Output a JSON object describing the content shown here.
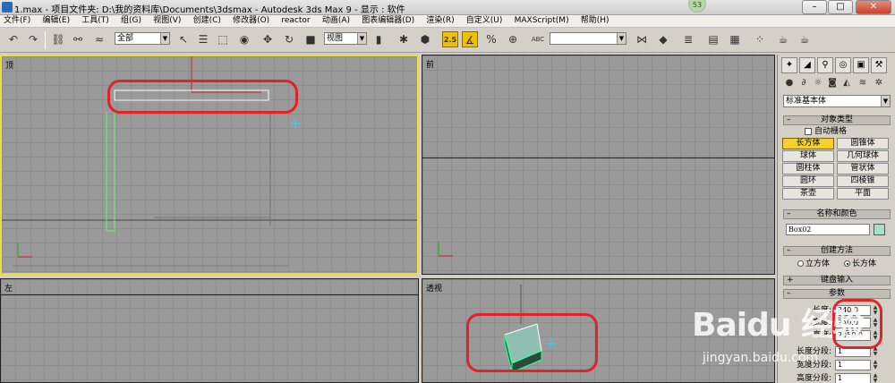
{
  "window": {
    "title": "1.max    - 项目文件夹: D:\\我的资料库\\Documents\\3dsmax    - Autodesk 3ds Max 9    - 显示 : 软件",
    "badge": "53"
  },
  "menu": [
    "文件(F)",
    "编辑(E)",
    "工具(T)",
    "组(G)",
    "视图(V)",
    "创建(C)",
    "修改器(O)",
    "reactor",
    "动画(A)",
    "图表编辑器(D)",
    "渲染(R)",
    "自定义(U)",
    "MAXScript(M)",
    "帮助(H)"
  ],
  "toolbar": {
    "selection_filter": "全部",
    "ref_coord": "视图",
    "snap_value": "2.5",
    "named_selection": "",
    "abc_label": "ABC"
  },
  "viewports": {
    "top": "顶",
    "front": "前",
    "left": "左",
    "perspective": "透视"
  },
  "panel": {
    "category": "标准基本体",
    "object_type_header": "对象类型",
    "autogrid": "自动栅格",
    "buttons": [
      "长方体",
      "圆锥体",
      "球体",
      "几何球体",
      "圆柱体",
      "管状体",
      "圆环",
      "四棱锥",
      "茶壶",
      "平面"
    ],
    "name_color_header": "名称和颜色",
    "object_name": "Box02",
    "object_color": "#9ee4c8",
    "creation_method_header": "创建方法",
    "method_cube": "立方体",
    "method_box": "长方体",
    "keyboard_entry_header": "键盘输入",
    "parameters_header": "参数",
    "params": [
      {
        "label": "长度:",
        "value": "240.0"
      },
      {
        "label": "宽度:",
        "value": "240.0"
      },
      {
        "label": "高度:",
        "value": "2050.0"
      },
      {
        "label": "长度分段:",
        "value": "1"
      },
      {
        "label": "宽度分段:",
        "value": "1"
      },
      {
        "label": "高度分段:",
        "value": "1"
      }
    ]
  },
  "watermark": {
    "logo": "Baidu 经验",
    "url": "jingyan.baidu.com"
  }
}
